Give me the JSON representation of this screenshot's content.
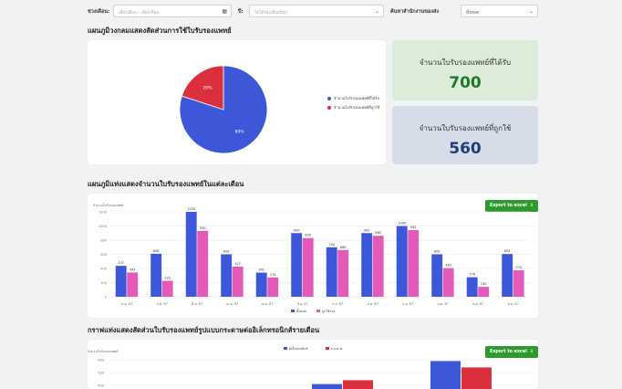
{
  "filters": {
    "period_label": "ช่วงเดือน:",
    "period_placeholder": "เลือกเดือน - เลือกเดือน",
    "year_label": "ปี:",
    "year_placeholder": "ไม่ได้รองเลือกปีทุก",
    "office_label": "ค้นหาสำนักงานของส่ง",
    "office_value": "ทั้งหมด"
  },
  "pie_section": {
    "title": "แผนภูมิวงกลมแสดงสัดส่วนการใช้ใบรับรองแพทย์",
    "legend": [
      "จำนวนใบรับรองแพทย์ที่ได้รับ",
      "จำนวนใบรับรองแพทย์ที่ถูกใช้"
    ]
  },
  "stats": [
    {
      "label": "จำนวนใบรับรองแพทย์ที่ได้รับ",
      "value": "700",
      "bg": "#dcecd9",
      "color": "#1e7a2a"
    },
    {
      "label": "จำนวนใบรับรองแพทย์ที่ถูกใช้",
      "value": "560",
      "bg": "#d6dde9",
      "color": "#1c3f7a"
    }
  ],
  "bar_section": {
    "title": "แผนภูมิแท่งแสดงจำนวนใบรับรองแพทย์ในแต่ละเดือน",
    "export_label": "Export to excel"
  },
  "bottom_section": {
    "title": "กราฟแท่งแสดงสัดส่วนใบรับรองแพทย์รูปแบบกระดาษต่ออิเล็กทรอนิกส์รายเดือน",
    "export_label": "Export to excel"
  },
  "colors": {
    "blue": "#3c57d8",
    "red": "#dc2f3e",
    "pink": "#e45ab8",
    "green": "#2e9a2e"
  },
  "chart_data": [
    {
      "type": "pie",
      "categories": [
        "จำนวนใบรับรองแพทย์ที่ได้รับ",
        "จำนวนใบรับรองแพทย์ที่ถูกใช้"
      ],
      "values": [
        80,
        20
      ],
      "labels": [
        "80%",
        "20%"
      ]
    },
    {
      "type": "bar",
      "ylabel": "จำนวนใบรับรองแพทย์",
      "ylim": [
        0,
        1200
      ],
      "yticks": [
        0,
        200,
        400,
        600,
        800,
        1000,
        1200
      ],
      "categories": [
        "ม.ค. 67",
        "ก.พ. 67",
        "มี.ค. 67",
        "เม.ย. 67",
        "พ.ค. 67",
        "มิ.ย. 67",
        "ก.ค. 67",
        "ส.ค. 67",
        "ก.ย. 67",
        "ต.ค. 67",
        "พ.ย. 67",
        "ธ.ค. 67"
      ],
      "series": [
        {
          "name": "ทั้งหมด",
          "values": [
            437,
            608,
            1200,
            600,
            341,
            900,
            700,
            900,
            1000,
            600,
            276,
            604
          ]
        },
        {
          "name": "ถูกใช้งาน",
          "values": [
            343,
            225,
            930,
            427,
            274,
            830,
            660,
            862,
            942,
            405,
            140,
            374
          ]
        }
      ],
      "grid": true,
      "legend": "bottom"
    },
    {
      "type": "bar",
      "ylabel": "จำนวนใบรับรองแพทย์",
      "yticks": [
        600,
        500,
        400
      ],
      "series": [
        {
          "name": "อิเล็กทรอนิกส์",
          "values": [
            410,
            590
          ]
        },
        {
          "name": "กระดาษ",
          "values": [
            440,
            540
          ]
        }
      ],
      "legend": "top"
    }
  ]
}
